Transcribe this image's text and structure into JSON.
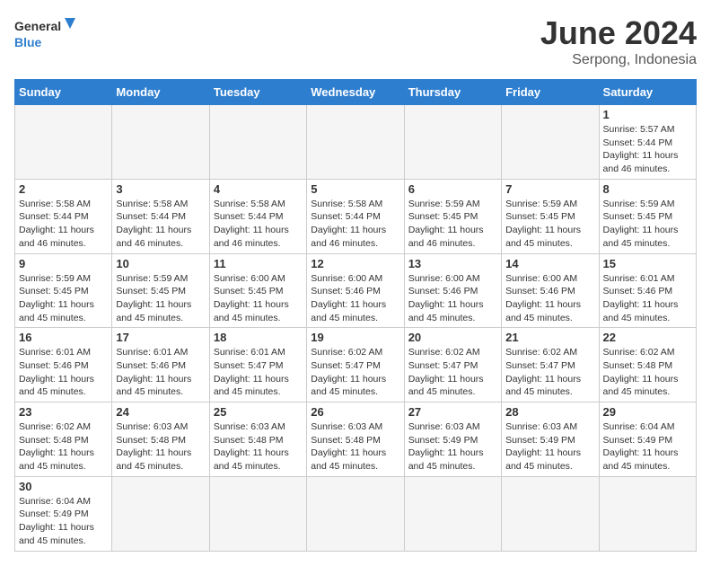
{
  "logo": {
    "general": "General",
    "blue": "Blue"
  },
  "title": "June 2024",
  "subtitle": "Serpong, Indonesia",
  "days_of_week": [
    "Sunday",
    "Monday",
    "Tuesday",
    "Wednesday",
    "Thursday",
    "Friday",
    "Saturday"
  ],
  "weeks": [
    [
      {
        "day": "",
        "info": ""
      },
      {
        "day": "",
        "info": ""
      },
      {
        "day": "",
        "info": ""
      },
      {
        "day": "",
        "info": ""
      },
      {
        "day": "",
        "info": ""
      },
      {
        "day": "",
        "info": ""
      },
      {
        "day": "1",
        "info": "Sunrise: 5:57 AM\nSunset: 5:44 PM\nDaylight: 11 hours and 46 minutes."
      }
    ],
    [
      {
        "day": "2",
        "info": "Sunrise: 5:58 AM\nSunset: 5:44 PM\nDaylight: 11 hours and 46 minutes."
      },
      {
        "day": "3",
        "info": "Sunrise: 5:58 AM\nSunset: 5:44 PM\nDaylight: 11 hours and 46 minutes."
      },
      {
        "day": "4",
        "info": "Sunrise: 5:58 AM\nSunset: 5:44 PM\nDaylight: 11 hours and 46 minutes."
      },
      {
        "day": "5",
        "info": "Sunrise: 5:58 AM\nSunset: 5:44 PM\nDaylight: 11 hours and 46 minutes."
      },
      {
        "day": "6",
        "info": "Sunrise: 5:59 AM\nSunset: 5:45 PM\nDaylight: 11 hours and 46 minutes."
      },
      {
        "day": "7",
        "info": "Sunrise: 5:59 AM\nSunset: 5:45 PM\nDaylight: 11 hours and 45 minutes."
      },
      {
        "day": "8",
        "info": "Sunrise: 5:59 AM\nSunset: 5:45 PM\nDaylight: 11 hours and 45 minutes."
      }
    ],
    [
      {
        "day": "9",
        "info": "Sunrise: 5:59 AM\nSunset: 5:45 PM\nDaylight: 11 hours and 45 minutes."
      },
      {
        "day": "10",
        "info": "Sunrise: 5:59 AM\nSunset: 5:45 PM\nDaylight: 11 hours and 45 minutes."
      },
      {
        "day": "11",
        "info": "Sunrise: 6:00 AM\nSunset: 5:45 PM\nDaylight: 11 hours and 45 minutes."
      },
      {
        "day": "12",
        "info": "Sunrise: 6:00 AM\nSunset: 5:46 PM\nDaylight: 11 hours and 45 minutes."
      },
      {
        "day": "13",
        "info": "Sunrise: 6:00 AM\nSunset: 5:46 PM\nDaylight: 11 hours and 45 minutes."
      },
      {
        "day": "14",
        "info": "Sunrise: 6:00 AM\nSunset: 5:46 PM\nDaylight: 11 hours and 45 minutes."
      },
      {
        "day": "15",
        "info": "Sunrise: 6:01 AM\nSunset: 5:46 PM\nDaylight: 11 hours and 45 minutes."
      }
    ],
    [
      {
        "day": "16",
        "info": "Sunrise: 6:01 AM\nSunset: 5:46 PM\nDaylight: 11 hours and 45 minutes."
      },
      {
        "day": "17",
        "info": "Sunrise: 6:01 AM\nSunset: 5:46 PM\nDaylight: 11 hours and 45 minutes."
      },
      {
        "day": "18",
        "info": "Sunrise: 6:01 AM\nSunset: 5:47 PM\nDaylight: 11 hours and 45 minutes."
      },
      {
        "day": "19",
        "info": "Sunrise: 6:02 AM\nSunset: 5:47 PM\nDaylight: 11 hours and 45 minutes."
      },
      {
        "day": "20",
        "info": "Sunrise: 6:02 AM\nSunset: 5:47 PM\nDaylight: 11 hours and 45 minutes."
      },
      {
        "day": "21",
        "info": "Sunrise: 6:02 AM\nSunset: 5:47 PM\nDaylight: 11 hours and 45 minutes."
      },
      {
        "day": "22",
        "info": "Sunrise: 6:02 AM\nSunset: 5:48 PM\nDaylight: 11 hours and 45 minutes."
      }
    ],
    [
      {
        "day": "23",
        "info": "Sunrise: 6:02 AM\nSunset: 5:48 PM\nDaylight: 11 hours and 45 minutes."
      },
      {
        "day": "24",
        "info": "Sunrise: 6:03 AM\nSunset: 5:48 PM\nDaylight: 11 hours and 45 minutes."
      },
      {
        "day": "25",
        "info": "Sunrise: 6:03 AM\nSunset: 5:48 PM\nDaylight: 11 hours and 45 minutes."
      },
      {
        "day": "26",
        "info": "Sunrise: 6:03 AM\nSunset: 5:48 PM\nDaylight: 11 hours and 45 minutes."
      },
      {
        "day": "27",
        "info": "Sunrise: 6:03 AM\nSunset: 5:49 PM\nDaylight: 11 hours and 45 minutes."
      },
      {
        "day": "28",
        "info": "Sunrise: 6:03 AM\nSunset: 5:49 PM\nDaylight: 11 hours and 45 minutes."
      },
      {
        "day": "29",
        "info": "Sunrise: 6:04 AM\nSunset: 5:49 PM\nDaylight: 11 hours and 45 minutes."
      }
    ],
    [
      {
        "day": "30",
        "info": "Sunrise: 6:04 AM\nSunset: 5:49 PM\nDaylight: 11 hours and 45 minutes."
      },
      {
        "day": "",
        "info": ""
      },
      {
        "day": "",
        "info": ""
      },
      {
        "day": "",
        "info": ""
      },
      {
        "day": "",
        "info": ""
      },
      {
        "day": "",
        "info": ""
      },
      {
        "day": "",
        "info": ""
      }
    ]
  ]
}
